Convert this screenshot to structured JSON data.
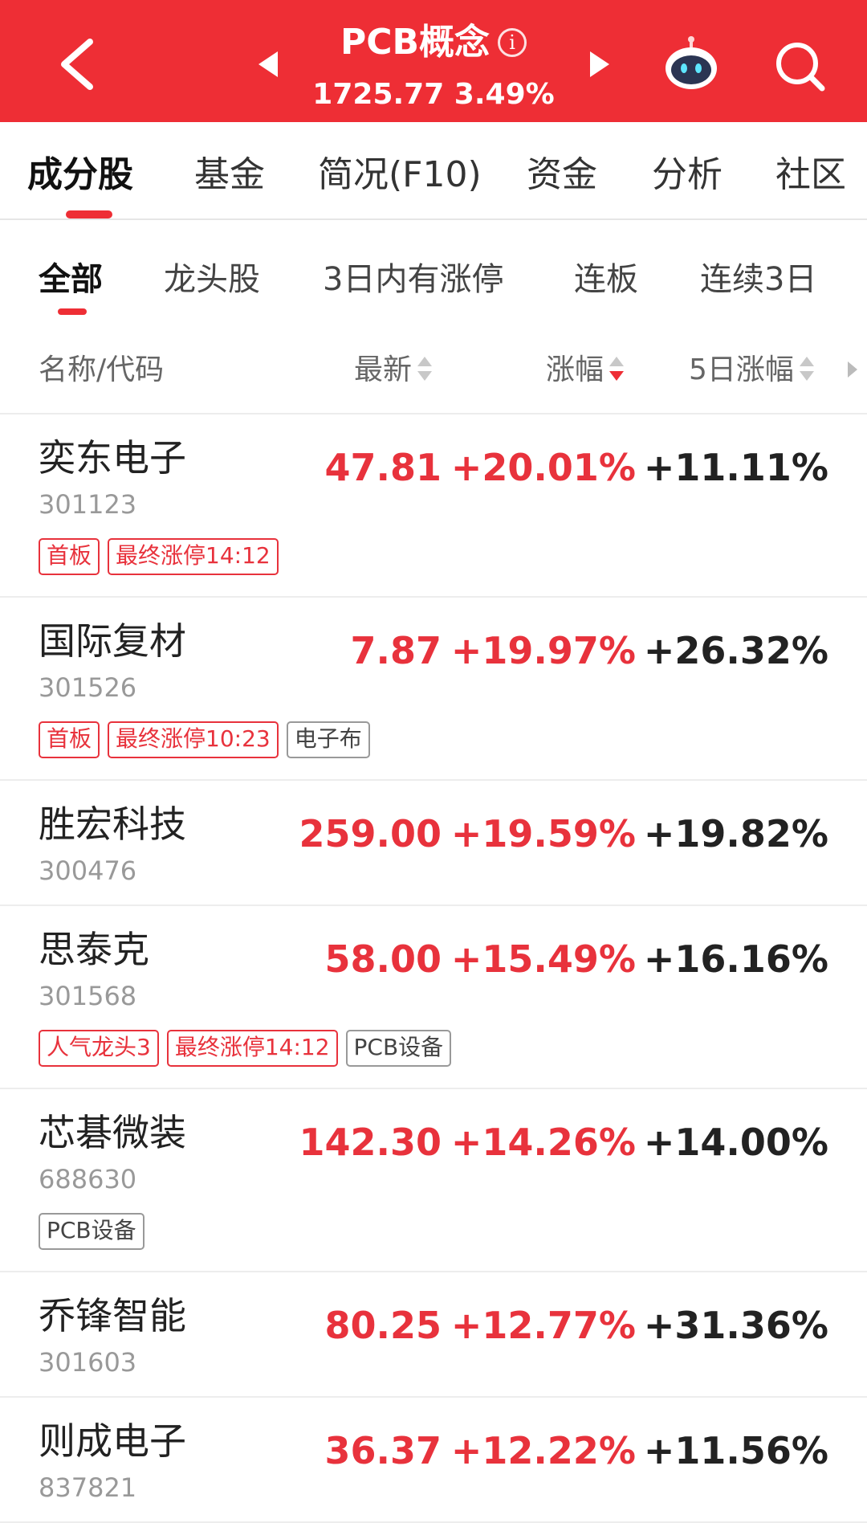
{
  "header": {
    "title": "PCB概念",
    "subtitle": "1725.77 3.49%",
    "info_icon": "info-icon",
    "back_icon": "chevron-left-icon",
    "robot_icon": "robot-assistant-icon",
    "search_icon": "search-icon",
    "color_bg": "#ee2e35"
  },
  "main_tabs": [
    "成分股",
    "基金",
    "简况(F10)",
    "资金",
    "分析",
    "社区"
  ],
  "sub_tabs": [
    "全部",
    "龙头股",
    "3日内有涨停",
    "连板",
    "连续3日"
  ],
  "columns": {
    "name": "名称/代码",
    "latest": "最新",
    "change": "涨幅",
    "change5": "5日涨幅"
  },
  "rows": [
    {
      "name": "奕东电子",
      "code": "301123",
      "price": "47.81",
      "change": "+20.01%",
      "change5": "+11.11%",
      "tags": [
        "首板",
        "最终涨停14:12"
      ]
    },
    {
      "name": "国际复材",
      "code": "301526",
      "price": "7.87",
      "change": "+19.97%",
      "change5": "+26.32%",
      "tags": [
        "首板",
        "最终涨停10:23",
        "电子布"
      ]
    },
    {
      "name": "胜宏科技",
      "code": "300476",
      "price": "259.00",
      "change": "+19.59%",
      "change5": "+19.82%",
      "tags": []
    },
    {
      "name": "思泰克",
      "code": "301568",
      "price": "58.00",
      "change": "+15.49%",
      "change5": "+16.16%",
      "tags": [
        "人气龙头3",
        "最终涨停14:12",
        "PCB设备"
      ]
    },
    {
      "name": "芯碁微装",
      "code": "688630",
      "price": "142.30",
      "change": "+14.26%",
      "change5": "+14.00%",
      "tags": [
        "PCB设备"
      ]
    },
    {
      "name": "乔锋智能",
      "code": "301603",
      "price": "80.25",
      "change": "+12.77%",
      "change5": "+31.36%",
      "tags": []
    },
    {
      "name": "则成电子",
      "code": "837821",
      "price": "36.37",
      "change": "+12.22%",
      "change5": "+11.56%",
      "tags": []
    }
  ],
  "colors": {
    "up": "#e8323c",
    "accent": "#ee2e35",
    "tag_gray": "#999999"
  }
}
